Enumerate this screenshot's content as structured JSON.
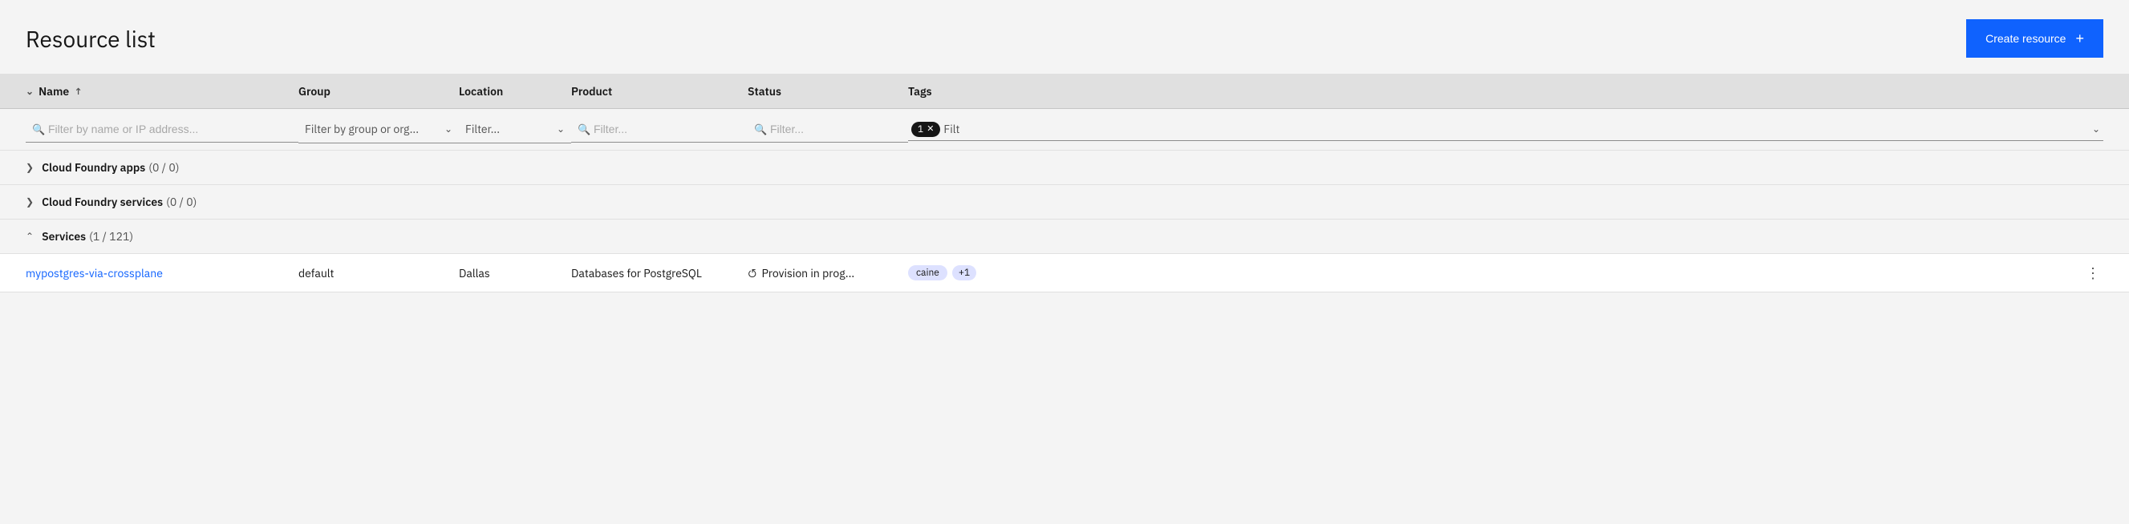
{
  "header": {
    "title": "Resource list",
    "create_button_label": "Create resource",
    "plus_symbol": "+"
  },
  "table": {
    "columns": {
      "name": "Name",
      "group": "Group",
      "location": "Location",
      "product": "Product",
      "status": "Status",
      "tags": "Tags"
    },
    "filters": {
      "name_placeholder": "Filter by name or IP address...",
      "group_placeholder": "Filter by group or org...",
      "location_placeholder": "Filter...",
      "product_placeholder": "Filter...",
      "status_placeholder": "Filter...",
      "tags_active_tag": "1",
      "tags_placeholder": "Filt"
    },
    "sections": [
      {
        "id": "cloud-foundry-apps",
        "label": "Cloud Foundry apps",
        "count": "(0 / 0)",
        "expanded": false,
        "rows": []
      },
      {
        "id": "cloud-foundry-services",
        "label": "Cloud Foundry services",
        "count": "(0 / 0)",
        "expanded": false,
        "rows": []
      },
      {
        "id": "services",
        "label": "Services",
        "count": "(1 / 121)",
        "expanded": true,
        "rows": [
          {
            "name": "mypostgres-via-crossplane",
            "group": "default",
            "location": "Dallas",
            "product": "Databases for PostgreSQL",
            "status": "Provision in prog...",
            "status_icon": "spinning",
            "tags": [
              "caine"
            ],
            "tags_more": "+1"
          }
        ]
      }
    ]
  }
}
